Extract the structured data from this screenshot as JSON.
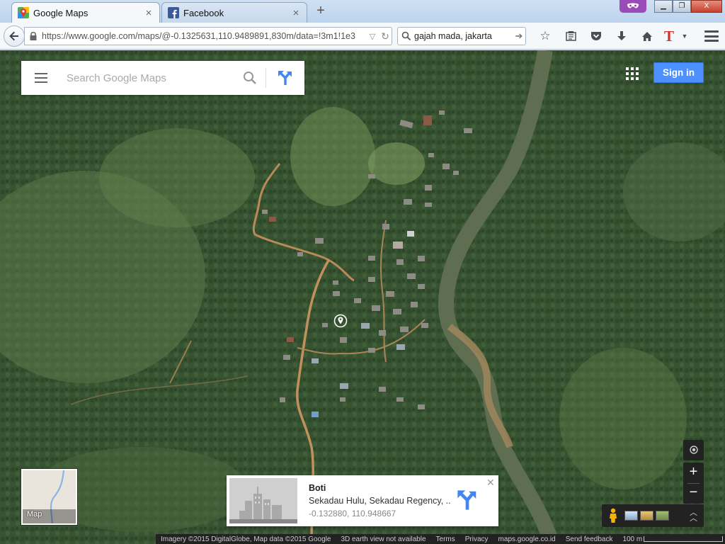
{
  "browser": {
    "tabs": [
      {
        "label": "Google Maps",
        "active": true,
        "icon": "google-maps-favicon"
      },
      {
        "label": "Facebook",
        "active": false,
        "icon": "facebook-favicon"
      }
    ],
    "new_tab_label": "+",
    "address_url": "https://www.google.com/maps/@-0.1325631,110.9489891,830m/data=!3m1!1e3",
    "search_value": "gajah mada, jakarta",
    "window_buttons": {
      "minimize": "▁",
      "restore": "❐",
      "close": "X"
    }
  },
  "maps": {
    "search_placeholder": "Search Google Maps",
    "signin_label": "Sign in",
    "minimap_label": "Map",
    "place_card": {
      "name": "Boti",
      "address": "Sekadau Hulu, Sekadau Regency, ...",
      "coords": "-0.132880, 110.948667",
      "close_label": "✕"
    },
    "zoom_in_label": "+",
    "zoom_out_label": "−",
    "footer": {
      "imagery": "Imagery ©2015 DigitalGlobe, Map data ©2015 Google",
      "earth_view": "3D earth view not available",
      "terms": "Terms",
      "privacy": "Privacy",
      "domain": "maps.google.co.id",
      "feedback": "Send feedback",
      "scale": "100 m"
    }
  },
  "colors": {
    "signin_blue": "#4d90fe",
    "forest_green": "#3c5a35",
    "river_brown": "#7a6a48",
    "dirt_road": "#b98a5a"
  }
}
